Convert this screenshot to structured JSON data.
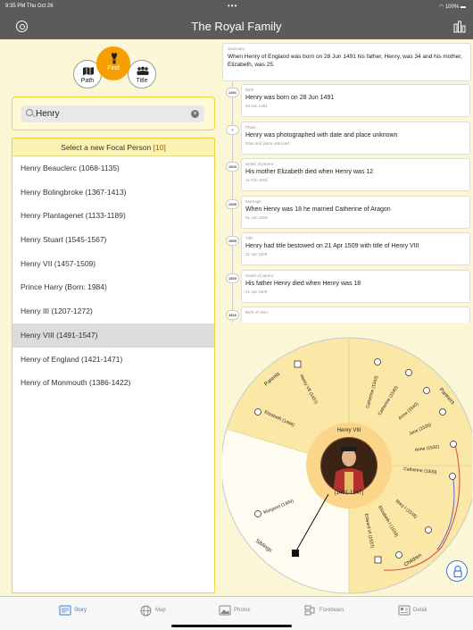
{
  "status_bar": {
    "time": "9:35 PM  Thu Oct 26",
    "dots": "•••",
    "battery": "100%"
  },
  "app": {
    "title": "The Royal Family"
  },
  "modes": [
    {
      "name": "path",
      "label": "Path",
      "icon": "map-icon"
    },
    {
      "name": "find",
      "label": "Find",
      "icon": "flashlight-icon",
      "active": true
    },
    {
      "name": "title",
      "label": "Title",
      "icon": "people-icon"
    }
  ],
  "search": {
    "value": "Henry",
    "placeholder": "Search"
  },
  "list": {
    "header": "Select a new Focal Person",
    "count": "[10]",
    "people": [
      "Henry Beauclerc (1068-1135)",
      "Henry Bolingbroke (1367-1413)",
      "Henry Plantagenet (1133-1189)",
      "Henry Stuart (1545-1567)",
      "Henry VII (1457-1509)",
      "Prince Harry (Born: 1984)",
      "Henry III  (1207-1272)",
      "Henry VIII (1491-1547)",
      "Henry of England (1421-1471)",
      "Henry of Monmouth (1386-1422)"
    ],
    "selected_index": 7
  },
  "story": {
    "summary_caption": "Summary",
    "summary_text": "When Henry of England was born on 28 Jun 1491 his father, Henry, was 34 and his mother, Elizabeth, was 25.",
    "events": [
      {
        "year": "1491",
        "caption": "Birth",
        "headline": "Henry was born on 28 Jun 1491",
        "date": "28 Jun 1491"
      },
      {
        "year": "?",
        "caption": "Photo",
        "headline": "Henry was photographed with date and place unknown",
        "date": "Date and place unknown"
      },
      {
        "year": "1503",
        "caption": "Death of parent",
        "headline": "His mother Elizabeth died when Henry was 12",
        "date": "11 Feb 1503"
      },
      {
        "year": "1509",
        "caption": "Marriage",
        "headline": "When Henry was 18 he married Catherine of Aragon",
        "date": "01 Jan 1509"
      },
      {
        "year": "1509",
        "caption": "Title",
        "headline": "Henry had title bestowed on 21 Apr 1509 with title of Henry VIII",
        "date": "21 Apr 1509"
      },
      {
        "year": "1509",
        "caption": "Death of parent",
        "headline": "His father Henry died when Henry was 18",
        "date": "21 Apr 1509"
      },
      {
        "year": "1516",
        "caption": "Birth of child",
        "headline": "",
        "date": ""
      }
    ]
  },
  "wheel": {
    "focal_name": "Henry VIII",
    "focal_dates": "(1491-1547)",
    "sections": {
      "parents": "Parents",
      "partners": "Partners",
      "children": "Children",
      "siblings": "Siblings"
    },
    "parents": [
      "Henry VII (1457)",
      "Elizabeth (1466)"
    ],
    "partners": [
      "Catherine (1543)",
      "Catherine (1540)",
      "Anne (1540)",
      "Jane (1536)",
      "Anne (1532)",
      "Catherine (1509)"
    ],
    "children": [
      "Mary I (1516)",
      "Elizabeth I (1533)",
      "Edward VI (1537)"
    ],
    "siblings": [
      "Margaret (1489)"
    ]
  },
  "tabs": [
    {
      "name": "story",
      "label": "Story",
      "active": true
    },
    {
      "name": "map",
      "label": "Map"
    },
    {
      "name": "photos",
      "label": "Photos"
    },
    {
      "name": "forebears",
      "label": "Forebears"
    },
    {
      "name": "detail",
      "label": "Detail"
    }
  ],
  "colors": {
    "accent": "#f5a000",
    "ring": "#fbe7a6",
    "light_ring": "#fdf2c8",
    "tab_active": "#3b7dd8",
    "bar": "#5b5b5b"
  }
}
